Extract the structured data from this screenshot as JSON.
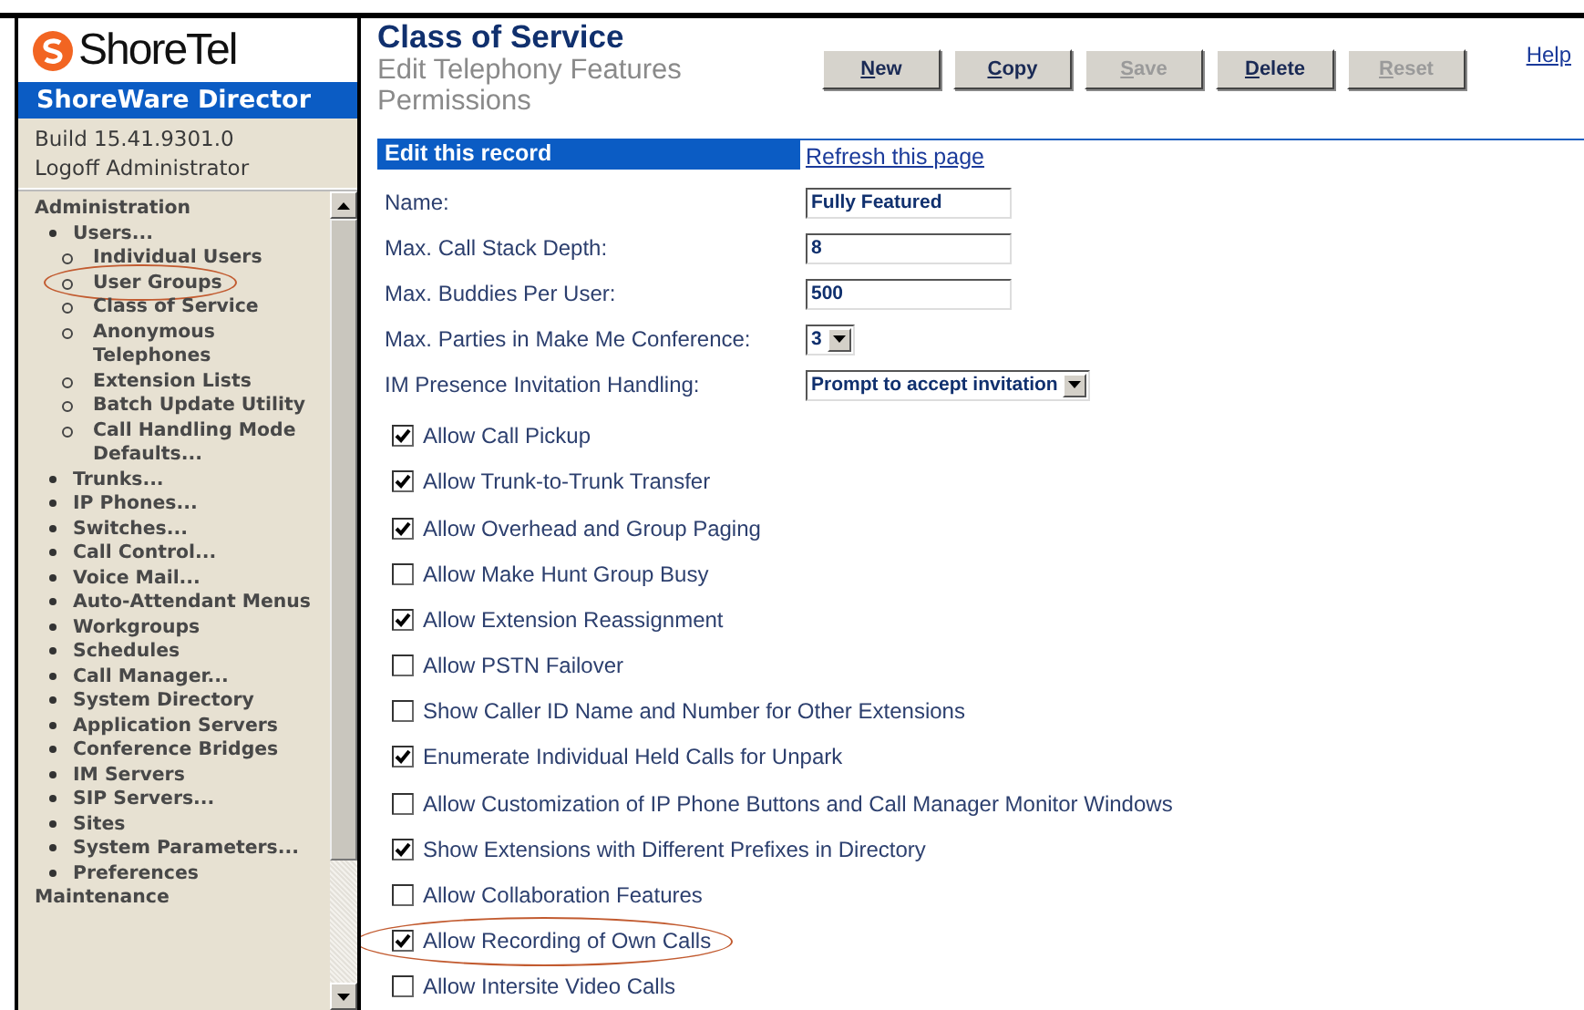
{
  "sidebar": {
    "logo": "ShoreTel",
    "product": "ShoreWare Director",
    "build": "Build 15.41.9301.0",
    "logoff": "Logoff Administrator",
    "nav": [
      {
        "label": "Administration",
        "children": [
          {
            "label": "Users...",
            "children": [
              {
                "label": "Individual Users",
                "circled": false
              },
              {
                "label": "User Groups",
                "circled": true
              },
              {
                "label": "Class of Service",
                "circled": false
              },
              {
                "label": "Anonymous Telephones",
                "circled": false
              },
              {
                "label": "Extension Lists",
                "circled": false
              },
              {
                "label": "Batch Update Utility",
                "circled": false
              },
              {
                "label": "Call Handling Mode Defaults...",
                "circled": false
              }
            ]
          },
          {
            "label": "Trunks..."
          },
          {
            "label": "IP Phones..."
          },
          {
            "label": "Switches..."
          },
          {
            "label": "Call Control..."
          },
          {
            "label": "Voice Mail..."
          },
          {
            "label": "Auto-Attendant Menus"
          },
          {
            "label": "Workgroups"
          },
          {
            "label": "Schedules"
          },
          {
            "label": "Call Manager..."
          },
          {
            "label": "System Directory"
          },
          {
            "label": "Application Servers"
          },
          {
            "label": "Conference Bridges"
          },
          {
            "label": "IM Servers"
          },
          {
            "label": "SIP Servers..."
          },
          {
            "label": "Sites"
          },
          {
            "label": "System Parameters..."
          },
          {
            "label": "Preferences"
          }
        ]
      },
      {
        "label": "Maintenance"
      }
    ]
  },
  "header": {
    "title": "Class of Service",
    "subtitle": "Edit Telephony Features Permissions",
    "help": "Help",
    "buttons": [
      {
        "label": "New",
        "disabled": false
      },
      {
        "label": "Copy",
        "disabled": false
      },
      {
        "label": "Save",
        "disabled": true
      },
      {
        "label": "Delete",
        "disabled": false
      },
      {
        "label": "Reset",
        "disabled": true
      }
    ]
  },
  "form": {
    "section": "Edit this record",
    "refresh": "Refresh this page",
    "fields": [
      {
        "kind": "text",
        "label": "Name:",
        "value": "Fully Featured"
      },
      {
        "kind": "text",
        "label": "Max. Call Stack Depth:",
        "value": "8"
      },
      {
        "kind": "text",
        "label": "Max. Buddies Per User:",
        "value": "500"
      },
      {
        "kind": "select",
        "label": "Max. Parties in Make Me Conference:",
        "value": "3"
      },
      {
        "kind": "select",
        "label": "IM Presence Invitation Handling:",
        "value": "Prompt to accept invitation"
      }
    ],
    "permissions": [
      {
        "label": "Allow Call Pickup",
        "checked": true,
        "circled": false
      },
      {
        "label": "Allow Trunk-to-Trunk Transfer",
        "checked": true,
        "circled": false
      },
      {
        "label": "Allow Overhead and Group Paging",
        "checked": true,
        "circled": false
      },
      {
        "label": "Allow Make Hunt Group Busy",
        "checked": false,
        "circled": false
      },
      {
        "label": "Allow Extension Reassignment",
        "checked": true,
        "circled": false
      },
      {
        "label": "Allow PSTN Failover",
        "checked": false,
        "circled": false
      },
      {
        "label": "Show Caller ID Name and Number for Other Extensions",
        "checked": false,
        "circled": false
      },
      {
        "label": "Enumerate Individual Held Calls for Unpark",
        "checked": true,
        "circled": false
      },
      {
        "label": "Allow Customization of IP Phone Buttons and Call Manager Monitor Windows",
        "checked": false,
        "circled": false
      },
      {
        "label": "Show Extensions with Different Prefixes in Directory",
        "checked": true,
        "circled": false
      },
      {
        "label": "Allow Collaboration Features",
        "checked": false,
        "circled": false
      },
      {
        "label": "Allow Recording of Own Calls",
        "checked": true,
        "circled": true
      },
      {
        "label": "Allow Intersite Video Calls",
        "checked": false,
        "circled": false
      }
    ]
  }
}
